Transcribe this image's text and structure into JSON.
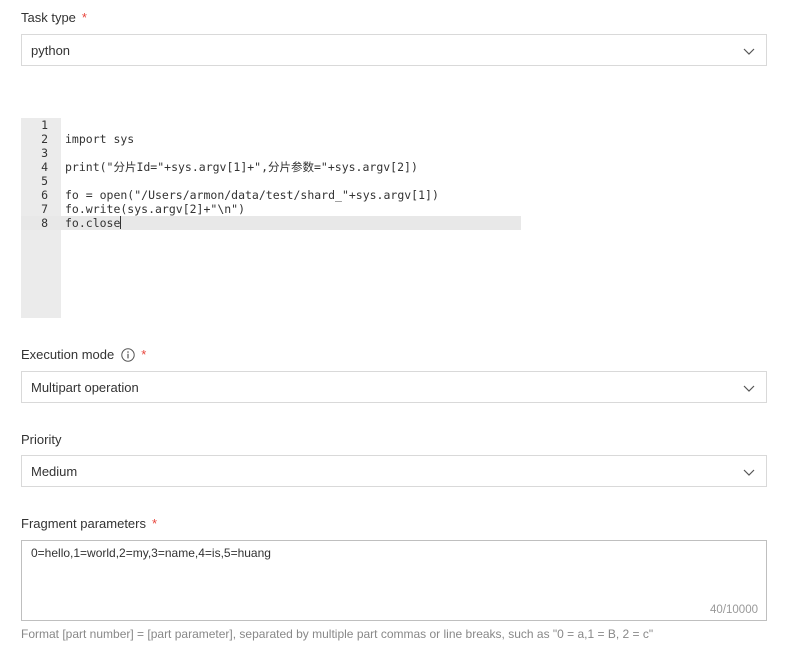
{
  "task_type": {
    "label": "Task type",
    "required_mark": "*",
    "value": "python"
  },
  "code_editor": {
    "lines": [
      {
        "number": "1",
        "text": ""
      },
      {
        "number": "2",
        "text": "import sys"
      },
      {
        "number": "3",
        "text": ""
      },
      {
        "number": "4",
        "text": "print(\"分片Id=\"+sys.argv[1]+\",分片参数=\"+sys.argv[2])"
      },
      {
        "number": "5",
        "text": ""
      },
      {
        "number": "6",
        "text": "fo = open(\"/Users/armon/data/test/shard_\"+sys.argv[1])"
      },
      {
        "number": "7",
        "text": "fo.write(sys.argv[2]+\"\\n\")"
      },
      {
        "number": "8",
        "text": "fo.close"
      }
    ],
    "active_line": 8
  },
  "execution_mode": {
    "label": "Execution mode",
    "required_mark": "*",
    "value": "Multipart operation"
  },
  "priority": {
    "label": "Priority",
    "value": "Medium"
  },
  "fragment_parameters": {
    "label": "Fragment parameters",
    "required_mark": "*",
    "value": "0=hello,1=world,2=my,3=name,4=is,5=huang",
    "counter": "40/10000",
    "hint": "Format [part number] = [part parameter], separated by multiple part commas or line breaks, such as \"0 = a,1 = B, 2 = c\""
  },
  "colors": {
    "required": "#e8453c",
    "border": "#d9d9d9",
    "gutter": "#ebebeb",
    "active_line": "#e8e8e8"
  }
}
